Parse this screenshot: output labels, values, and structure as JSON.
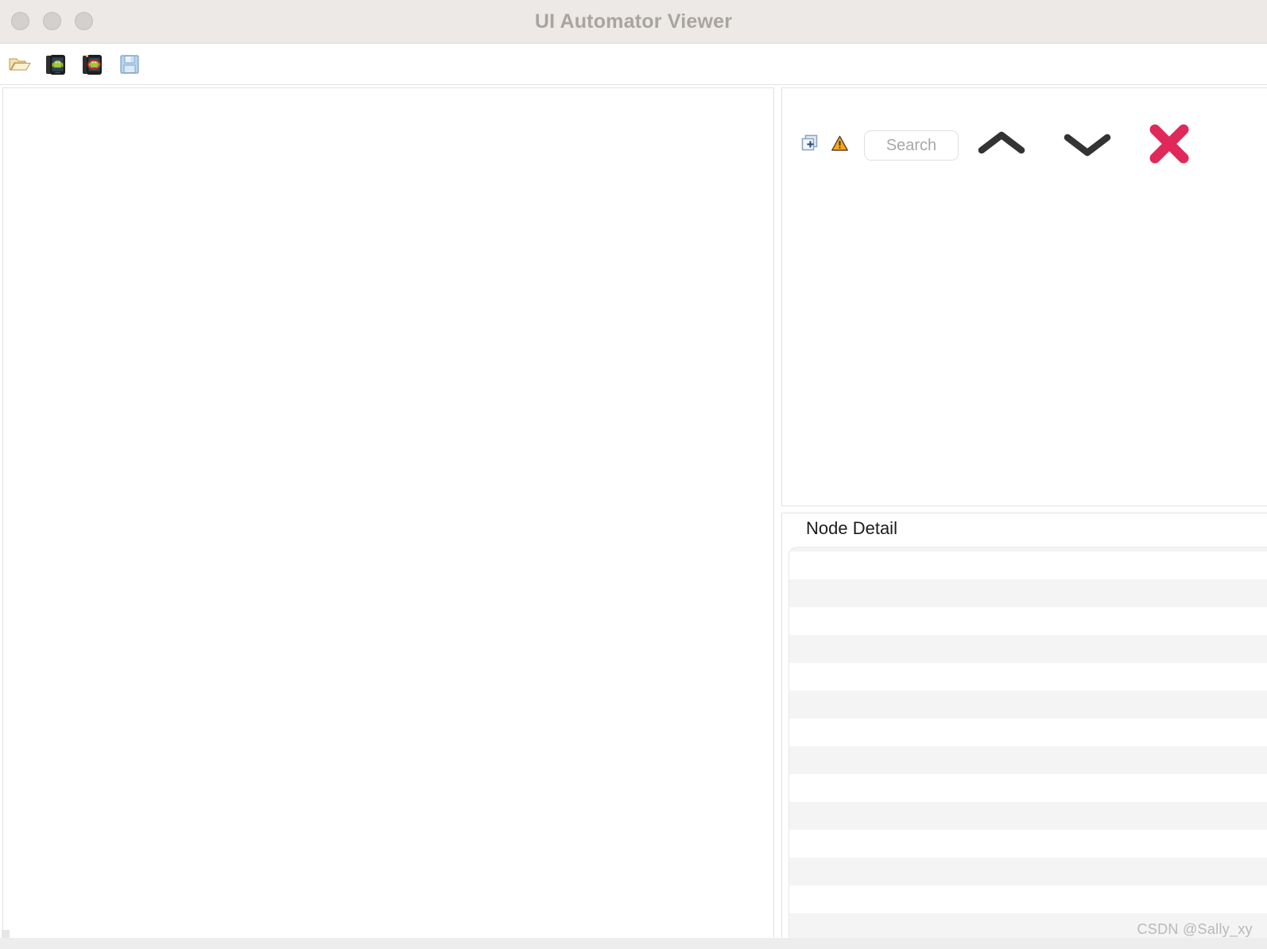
{
  "window": {
    "title": "UI Automator Viewer",
    "controls": [
      {
        "name": "close-button",
        "label": ""
      },
      {
        "name": "minimize-button",
        "label": ""
      },
      {
        "name": "maximize-button",
        "label": ""
      }
    ]
  },
  "toolbar": {
    "items": [
      {
        "icon": "open-folder-icon",
        "tooltip": "Open"
      },
      {
        "icon": "device-screenshot-icon",
        "tooltip": "Device Screenshot"
      },
      {
        "icon": "device-screenshot-compressed-icon",
        "tooltip": "Device Screenshot with Compressed Hierarchy"
      },
      {
        "icon": "save-floppy-icon",
        "tooltip": "Save"
      }
    ]
  },
  "tree_panel": {
    "content": ""
  },
  "search_toolbar": {
    "copy_icon": "stacked-windows-plus-icon",
    "warning_icon": "warning-triangle-icon",
    "search_placeholder": "Search",
    "search_value": "",
    "prev_icon": "chevron-up-icon",
    "next_icon": "chevron-down-icon",
    "close_icon": "close-x-icon",
    "close_color": "#e0285a"
  },
  "node_detail": {
    "title": "Node Detail",
    "rows": [
      {
        "key": "",
        "value": ""
      },
      {
        "key": "",
        "value": ""
      },
      {
        "key": "",
        "value": ""
      },
      {
        "key": "",
        "value": ""
      },
      {
        "key": "",
        "value": ""
      },
      {
        "key": "",
        "value": ""
      },
      {
        "key": "",
        "value": ""
      },
      {
        "key": "",
        "value": ""
      },
      {
        "key": "",
        "value": ""
      },
      {
        "key": "",
        "value": ""
      },
      {
        "key": "",
        "value": ""
      },
      {
        "key": "",
        "value": ""
      },
      {
        "key": "",
        "value": ""
      },
      {
        "key": "",
        "value": ""
      }
    ]
  },
  "watermark": {
    "text": "CSDN @Sally_xy"
  }
}
